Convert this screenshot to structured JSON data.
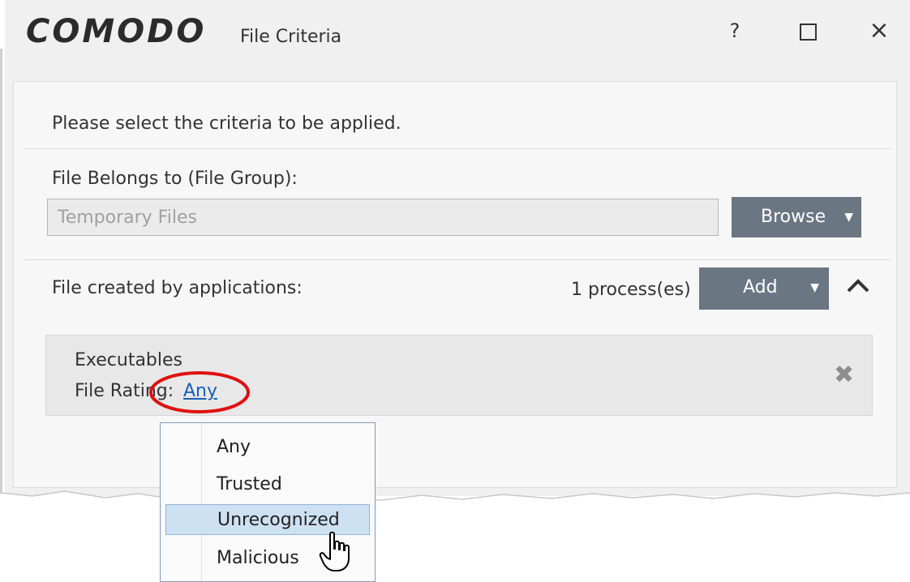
{
  "titlebar": {
    "logo": "COMODO",
    "title": "File Criteria",
    "help_label": "?",
    "maximize_icon": "maximize-icon",
    "close_icon": "close-icon"
  },
  "intro_text": "Please select the criteria to be applied.",
  "file_group": {
    "label": "File Belongs to (File Group):",
    "value": "Temporary Files",
    "browse_label": "Browse"
  },
  "apps": {
    "label": "File created by applications:",
    "count_text": "1 process(es)",
    "add_label": "Add",
    "collapse_icon": "chevron-up-icon",
    "entry": {
      "name": "Executables",
      "rating_label": "File Rating:",
      "rating_value": "Any",
      "remove_icon": "x-icon"
    }
  },
  "rating_menu": {
    "items": [
      "Any",
      "Trusted",
      "Unrecognized",
      "Malicious"
    ],
    "highlighted": "Unrecognized"
  },
  "colors": {
    "button_bg": "#6b7683",
    "link": "#1a5fb4",
    "highlight": "#cde1f3",
    "annotation": "#e01010"
  }
}
